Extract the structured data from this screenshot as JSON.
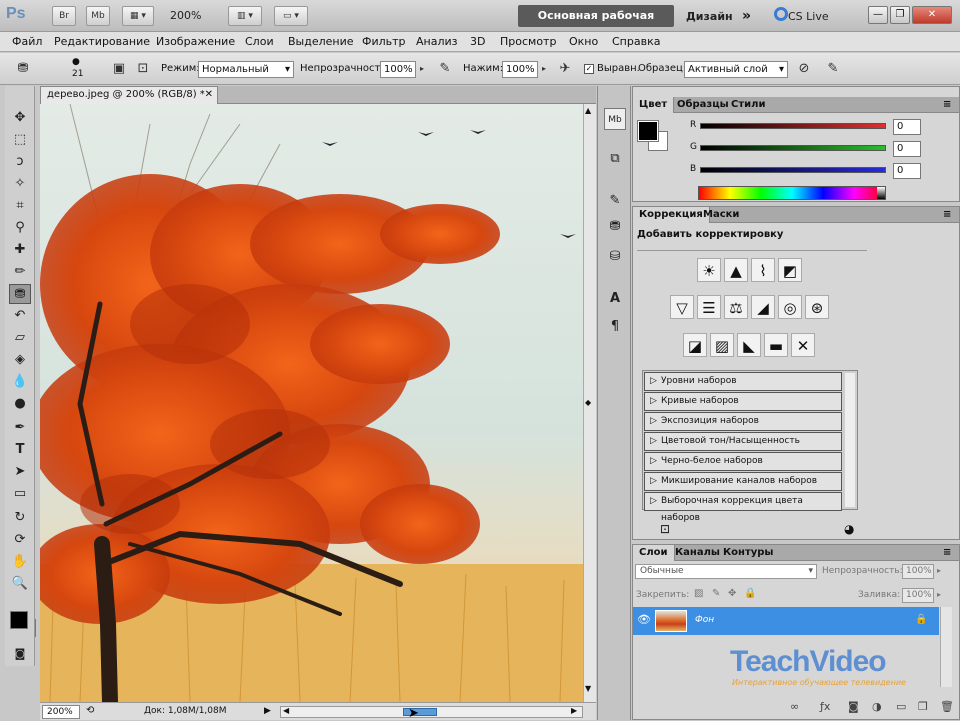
{
  "titlebar": {
    "logo": "Ps",
    "btn_br": "Br",
    "btn_mb": "Mb",
    "zoom": "200%",
    "workspace_main": "Основная рабочая среда",
    "workspace_design": "Дизайн",
    "more": "»",
    "cs_live": "CS Live",
    "win_min": "—",
    "win_max": "❐",
    "win_close": "✕"
  },
  "menubar": {
    "items": [
      "Файл",
      "Редактирование",
      "Изображение",
      "Слои",
      "Выделение",
      "Фильтр",
      "Анализ",
      "3D",
      "Просмотр",
      "Окно",
      "Справка"
    ]
  },
  "options": {
    "brush_size": "21",
    "mode_label": "Режим:",
    "mode_value": "Нормальный",
    "opacity_label": "Непрозрачность:",
    "opacity_value": "100%",
    "pressure_label": "Нажим:",
    "pressure_value": "100%",
    "aligned_label": "Выравн.",
    "sample_label": "Образец:",
    "sample_value": "Активный слой"
  },
  "document": {
    "tab_title": "дерево.jpeg @ 200% (RGB/8) *",
    "close": "✕",
    "zoom": "200%",
    "doc_info": "Док: 1,08M/1,08M"
  },
  "color_panel": {
    "tabs": [
      "Цвет",
      "Образцы",
      "Стили"
    ],
    "r_label": "R",
    "r_value": "0",
    "g_label": "G",
    "g_value": "0",
    "b_label": "B",
    "b_value": "0",
    "r_color": "#e03030",
    "g_color": "#28c028",
    "b_color": "#2a2ae0"
  },
  "adjust_panel": {
    "tabs": [
      "Коррекция",
      "Маски"
    ],
    "heading": "Добавить корректировку",
    "presets": [
      "Уровни наборов",
      "Кривые наборов",
      "Экспозиция наборов",
      "Цветовой тон/Насыщенность наборов",
      "Черно-белое наборов",
      "Микширование каналов наборов",
      "Выборочная коррекция цвета наборов"
    ]
  },
  "layers_panel": {
    "tabs": [
      "Слои",
      "Каналы",
      "Контуры"
    ],
    "blend_mode": "Обычные",
    "opacity_label": "Непрозрачность:",
    "opacity_value": "100%",
    "lock_label": "Закрепить:",
    "fill_label": "Заливка:",
    "fill_value": "100%",
    "layer_name": "Фон",
    "highlight_color": "#3d8fe3"
  },
  "watermark": {
    "brand": "TeachVideo",
    "tagline": "Интерактивное обучающее телевидение"
  }
}
